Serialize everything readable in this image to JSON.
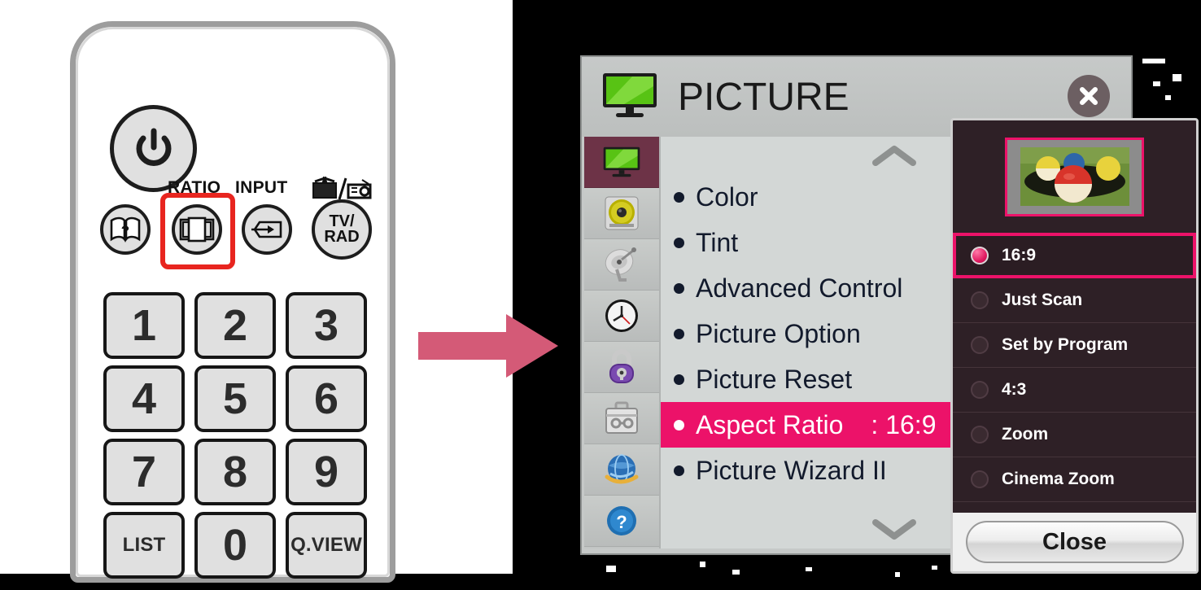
{
  "remote": {
    "power_button": "power-icon",
    "buttons_row": [
      {
        "name": "help",
        "icon": "book-question-icon",
        "label": ""
      },
      {
        "name": "ratio",
        "icon": "aspect-ratio-icon",
        "label": "RATIO"
      },
      {
        "name": "input",
        "icon": "input-arrow-icon",
        "label": "INPUT"
      },
      {
        "name": "tv-rad",
        "icon": "tv-radio-icon",
        "label": "TV/\nRAD"
      }
    ],
    "ratio_label": "RATIO",
    "input_label": "INPUT",
    "tvrad_line1": "TV/",
    "tvrad_line2": "RAD",
    "highlight_color": "#e8251f",
    "keypad": [
      "1",
      "2",
      "3",
      "4",
      "5",
      "6",
      "7",
      "8",
      "9",
      "LIST",
      "0",
      "Q.VIEW"
    ]
  },
  "arrow": {
    "direction": "right",
    "color": "#d45a77"
  },
  "osd": {
    "title": "PICTURE",
    "title_icon": "tv-screen-icon",
    "close_icon": "close-x-icon",
    "sidebar": [
      {
        "name": "picture",
        "icon": "tv-screen-icon",
        "active": true
      },
      {
        "name": "audio",
        "icon": "speaker-icon",
        "active": false
      },
      {
        "name": "channel",
        "icon": "satellite-dish-icon",
        "active": false
      },
      {
        "name": "time",
        "icon": "clock-icon",
        "active": false
      },
      {
        "name": "lock",
        "icon": "padlock-icon",
        "active": false
      },
      {
        "name": "option",
        "icon": "toolbox-icon",
        "active": false
      },
      {
        "name": "network",
        "icon": "globe-icon",
        "active": false
      },
      {
        "name": "support",
        "icon": "question-circle-icon",
        "active": false
      }
    ],
    "scroll_up_icon": "chevron-up-icon",
    "scroll_down_icon": "chevron-down-icon",
    "menu": [
      {
        "label": "Color",
        "value": "",
        "selected": false
      },
      {
        "label": "Tint",
        "value": "",
        "selected": false
      },
      {
        "label": "Advanced Control",
        "value": "",
        "selected": false
      },
      {
        "label": "Picture Option",
        "value": "",
        "selected": false
      },
      {
        "label": "Picture Reset",
        "value": "",
        "selected": false
      },
      {
        "label": "Aspect Ratio",
        "value": ": 16:9",
        "selected": true
      },
      {
        "label": "Picture Wizard II",
        "value": "",
        "selected": false
      }
    ],
    "highlight_color": "#ec1269"
  },
  "dropdown": {
    "thumbnail_label": "billiard-balls-preview",
    "options": [
      {
        "label": "16:9",
        "selected": true
      },
      {
        "label": "Just Scan",
        "selected": false
      },
      {
        "label": "Set by Program",
        "selected": false
      },
      {
        "label": "4:3",
        "selected": false
      },
      {
        "label": "Zoom",
        "selected": false
      },
      {
        "label": "Cinema Zoom",
        "selected": false
      }
    ],
    "close_label": "Close",
    "accent_color": "#ec1269",
    "background_color": "#2e2026"
  }
}
